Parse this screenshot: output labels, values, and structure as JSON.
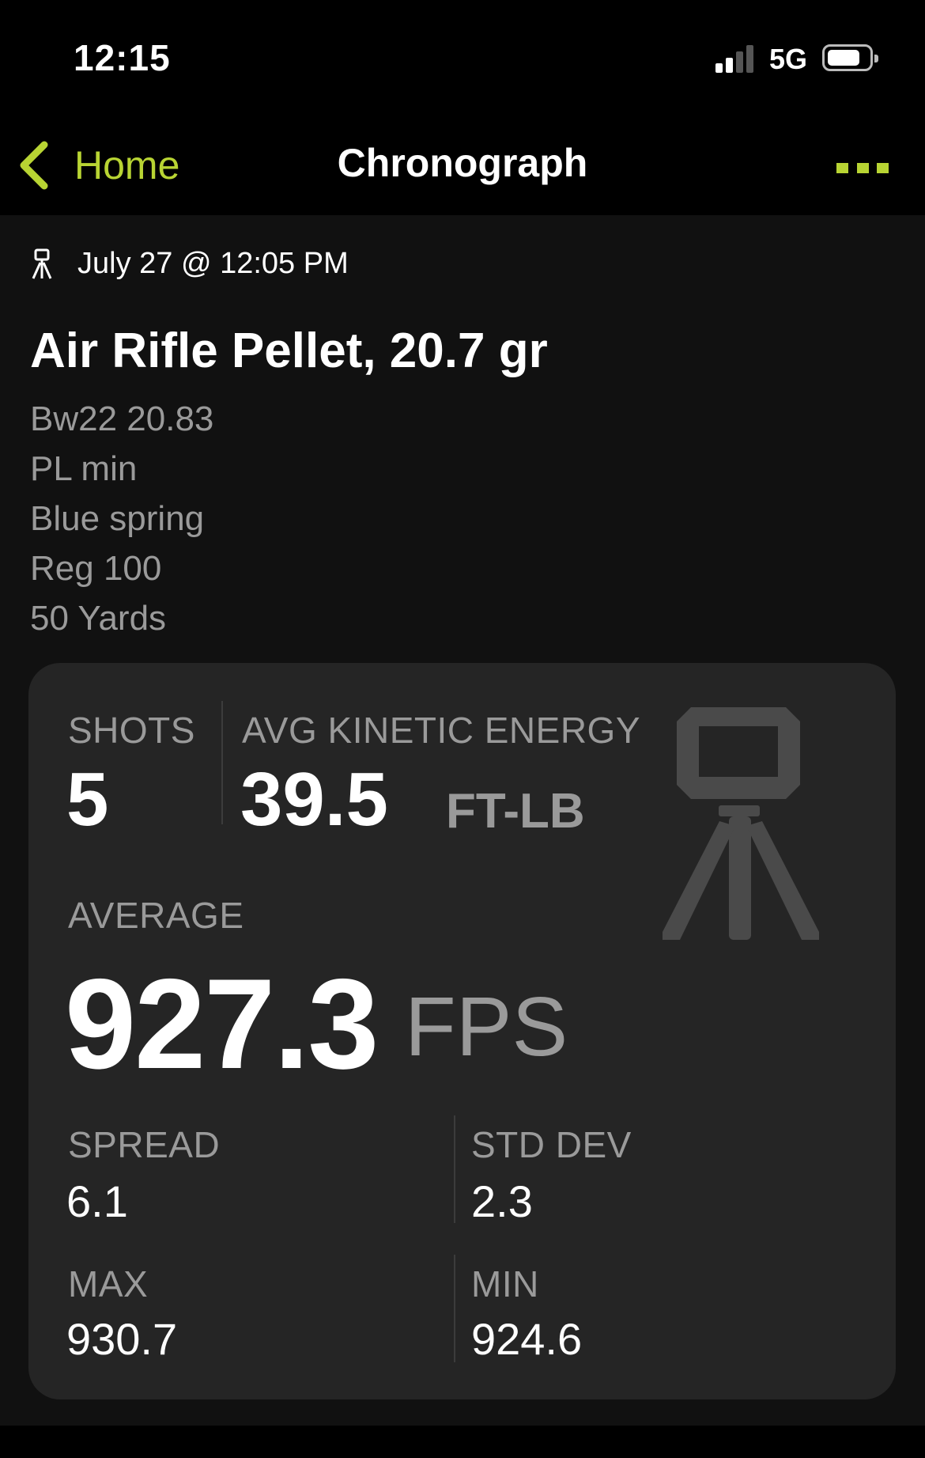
{
  "status_bar": {
    "time": "12:15",
    "network": "5G"
  },
  "nav": {
    "back_label": "Home",
    "title": "Chronograph",
    "accent_color": "#b8d433"
  },
  "session": {
    "date": "July 27 @ 12:05 PM",
    "ammo_title": "Air Rifle Pellet, 20.7 gr",
    "notes": [
      "Bw22 20.83",
      "PL min",
      "Blue spring",
      "Reg 100",
      "50 Yards"
    ]
  },
  "stats": {
    "shots_label": "SHOTS",
    "shots_value": "5",
    "ke_label": "AVG KINETIC ENERGY",
    "ke_value": "39.5",
    "ke_unit": "FT-LB",
    "average_label": "AVERAGE",
    "average_value": "927.3",
    "average_unit": "FPS",
    "spread_label": "SPREAD",
    "spread_value": "6.1",
    "stddev_label": "STD DEV",
    "stddev_value": "2.3",
    "max_label": "MAX",
    "max_value": "930.7",
    "min_label": "MIN",
    "min_value": "924.6"
  },
  "icons": {
    "back": "chevron-left-icon",
    "more": "more-dots-icon",
    "session": "tripod-icon",
    "device": "chronograph-device-icon"
  }
}
